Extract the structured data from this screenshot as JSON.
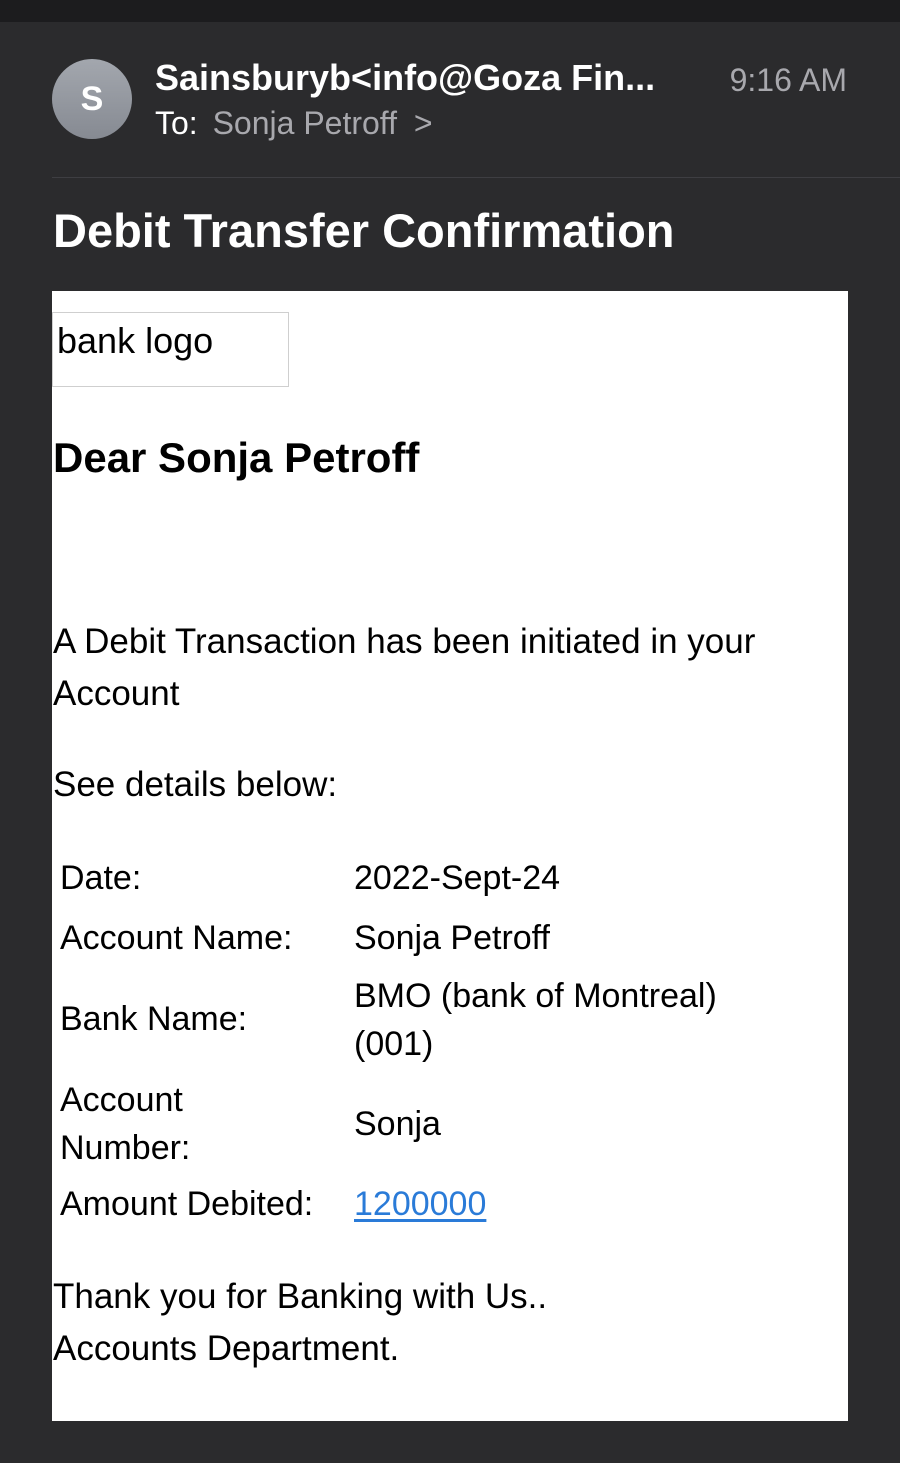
{
  "header": {
    "avatar_initial": "S",
    "sender": "Sainsburyb<info@Goza Fin...",
    "time": "9:16 AM",
    "to_label": "To:",
    "to_name": "Sonja Petroff",
    "to_chevron": ">"
  },
  "subject": "Debit Transfer Confirmation",
  "body": {
    "logo_alt": "bank logo",
    "greeting": "Dear Sonja Petroff",
    "intro": "A Debit Transaction has been initiated in your Account",
    "see_details": "See details below:",
    "details": [
      {
        "label": "Date:",
        "value": "2022-Sept-24"
      },
      {
        "label": "Account Name:",
        "value": "Sonja Petroff"
      },
      {
        "label": "Bank Name:",
        "value": "BMO (bank of Montreal) (001)"
      },
      {
        "label": "Account Number:",
        "value": "Sonja"
      },
      {
        "label": "Amount Debited:",
        "value": "1200000"
      }
    ],
    "closing_1": "Thank you for Banking with Us..",
    "closing_2": "Accounts Department."
  },
  "colors": {
    "background": "#2b2b2d",
    "link": "#2a7bd8",
    "secondary_text": "#a8a8ad"
  }
}
